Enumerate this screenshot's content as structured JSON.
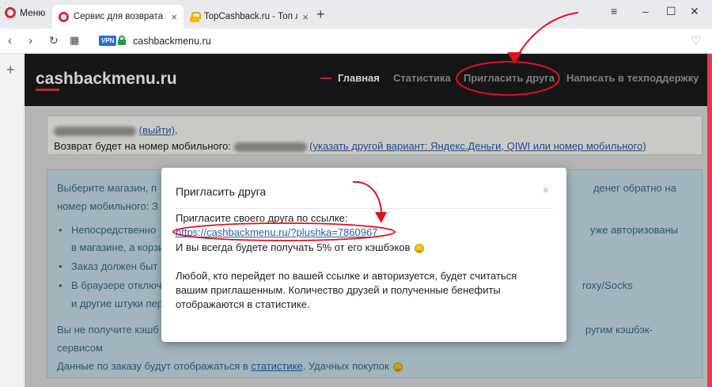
{
  "browser": {
    "menu_label": "Меню",
    "tabs": [
      {
        "title": "Сервис для возврата кэш",
        "active": true
      },
      {
        "title": "TopCashback.ru - Топ луч",
        "active": false
      }
    ],
    "new_tab": "+",
    "url": "cashbackmenu.ru",
    "vpn_badge": "VPN"
  },
  "sidebar": {
    "add_label": "+"
  },
  "site": {
    "logo": "cashbackmenu.ru",
    "nav": [
      {
        "label": "Главная",
        "active": true
      },
      {
        "label": "Статистика",
        "active": false
      },
      {
        "label": "Пригласить друга",
        "active": false
      },
      {
        "label": "Написать в техподдержку",
        "active": false
      }
    ],
    "user": {
      "logout_link": "(выйти)",
      "punct": ".",
      "refund_text": "Возврат будет на номер мобильного:",
      "change_link": "(указать другой вариант: Яндекс.Деньги, QIWI или номер мобильного)"
    },
    "info": {
      "intro_left": "Выберите магазин, п",
      "intro_right": "денег обратно на",
      "line2_left": "номер мобильного: З",
      "b1_left": "Непосредственно",
      "b1_right": "уже авторизованы",
      "b1_line2": "в магазине, а корзи",
      "b2_left": "Заказ должен быт",
      "b3_left": "В браузере отключ",
      "b3_right": "roxy/Socks",
      "b3_line2": "и другие штуки пер",
      "no_cb_left": "Вы не получите кэшб",
      "no_cb_right": "ругим кэшбэк-",
      "no_cb_line2": "сервисом",
      "orders_text": "Данные по заказу будут отображаться в",
      "orders_link": "статистике",
      "orders_tail": ". Удачных покупок"
    }
  },
  "modal": {
    "title": "Пригласить друга",
    "close": "×",
    "invite_text": "Пригласите своего друга по ссылке:",
    "invite_link": "https://cashbackmenu.ru/?plushka=7860967",
    "percent_text": "И вы всегда будете получать 5% от его кэшбэков",
    "p2_line1": "Любой, кто перейдет по вашей ссылке и авторизуется, будет считаться",
    "p2_line2": "вашим приглашенным. Количество друзей и полученные бенефиты",
    "p2_line3": "отображаются в статистике."
  },
  "colors": {
    "header_bg": "#1c1b1f",
    "accent_red": "#d9313f",
    "link_blue": "#2a5fa8",
    "info_bg": "#c6dde6",
    "annotation_red": "#e01020"
  }
}
